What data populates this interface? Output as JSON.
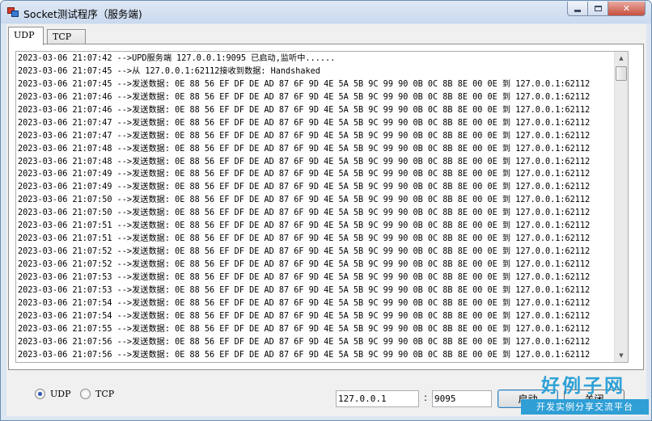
{
  "window": {
    "title": "Socket测试程序（服务端)"
  },
  "tabs": [
    {
      "label": "UDP",
      "active": true
    },
    {
      "label": "TCP",
      "active": false
    }
  ],
  "log": {
    "lines": [
      "2023-03-06 21:07:42 -->UPD服务端 127.0.0.1:9095 已启动,监听中......",
      "2023-03-06 21:07:45 -->从 127.0.0.1:62112接收到数据: Handshaked",
      "2023-03-06 21:07:45 -->发送数据: 0E 88 56 EF DF DE AD 87 6F 9D 4E 5A 5B 9C 99 90 0B 0C 8B 8E 00 0E 到 127.0.0.1:62112",
      "2023-03-06 21:07:46 -->发送数据: 0E 88 56 EF DF DE AD 87 6F 9D 4E 5A 5B 9C 99 90 0B 0C 8B 8E 00 0E 到 127.0.0.1:62112",
      "2023-03-06 21:07:46 -->发送数据: 0E 88 56 EF DF DE AD 87 6F 9D 4E 5A 5B 9C 99 90 0B 0C 8B 8E 00 0E 到 127.0.0.1:62112",
      "2023-03-06 21:07:47 -->发送数据: 0E 88 56 EF DF DE AD 87 6F 9D 4E 5A 5B 9C 99 90 0B 0C 8B 8E 00 0E 到 127.0.0.1:62112",
      "2023-03-06 21:07:47 -->发送数据: 0E 88 56 EF DF DE AD 87 6F 9D 4E 5A 5B 9C 99 90 0B 0C 8B 8E 00 0E 到 127.0.0.1:62112",
      "2023-03-06 21:07:48 -->发送数据: 0E 88 56 EF DF DE AD 87 6F 9D 4E 5A 5B 9C 99 90 0B 0C 8B 8E 00 0E 到 127.0.0.1:62112",
      "2023-03-06 21:07:48 -->发送数据: 0E 88 56 EF DF DE AD 87 6F 9D 4E 5A 5B 9C 99 90 0B 0C 8B 8E 00 0E 到 127.0.0.1:62112",
      "2023-03-06 21:07:49 -->发送数据: 0E 88 56 EF DF DE AD 87 6F 9D 4E 5A 5B 9C 99 90 0B 0C 8B 8E 00 0E 到 127.0.0.1:62112",
      "2023-03-06 21:07:49 -->发送数据: 0E 88 56 EF DF DE AD 87 6F 9D 4E 5A 5B 9C 99 90 0B 0C 8B 8E 00 0E 到 127.0.0.1:62112",
      "2023-03-06 21:07:50 -->发送数据: 0E 88 56 EF DF DE AD 87 6F 9D 4E 5A 5B 9C 99 90 0B 0C 8B 8E 00 0E 到 127.0.0.1:62112",
      "2023-03-06 21:07:50 -->发送数据: 0E 88 56 EF DF DE AD 87 6F 9D 4E 5A 5B 9C 99 90 0B 0C 8B 8E 00 0E 到 127.0.0.1:62112",
      "2023-03-06 21:07:51 -->发送数据: 0E 88 56 EF DF DE AD 87 6F 9D 4E 5A 5B 9C 99 90 0B 0C 8B 8E 00 0E 到 127.0.0.1:62112",
      "2023-03-06 21:07:51 -->发送数据: 0E 88 56 EF DF DE AD 87 6F 9D 4E 5A 5B 9C 99 90 0B 0C 8B 8E 00 0E 到 127.0.0.1:62112",
      "2023-03-06 21:07:52 -->发送数据: 0E 88 56 EF DF DE AD 87 6F 9D 4E 5A 5B 9C 99 90 0B 0C 8B 8E 00 0E 到 127.0.0.1:62112",
      "2023-03-06 21:07:52 -->发送数据: 0E 88 56 EF DF DE AD 87 6F 9D 4E 5A 5B 9C 99 90 0B 0C 8B 8E 00 0E 到 127.0.0.1:62112",
      "2023-03-06 21:07:53 -->发送数据: 0E 88 56 EF DF DE AD 87 6F 9D 4E 5A 5B 9C 99 90 0B 0C 8B 8E 00 0E 到 127.0.0.1:62112",
      "2023-03-06 21:07:53 -->发送数据: 0E 88 56 EF DF DE AD 87 6F 9D 4E 5A 5B 9C 99 90 0B 0C 8B 8E 00 0E 到 127.0.0.1:62112",
      "2023-03-06 21:07:54 -->发送数据: 0E 88 56 EF DF DE AD 87 6F 9D 4E 5A 5B 9C 99 90 0B 0C 8B 8E 00 0E 到 127.0.0.1:62112",
      "2023-03-06 21:07:54 -->发送数据: 0E 88 56 EF DF DE AD 87 6F 9D 4E 5A 5B 9C 99 90 0B 0C 8B 8E 00 0E 到 127.0.0.1:62112",
      "2023-03-06 21:07:55 -->发送数据: 0E 88 56 EF DF DE AD 87 6F 9D 4E 5A 5B 9C 99 90 0B 0C 8B 8E 00 0E 到 127.0.0.1:62112",
      "2023-03-06 21:07:56 -->发送数据: 0E 88 56 EF DF DE AD 87 6F 9D 4E 5A 5B 9C 99 90 0B 0C 8B 8E 00 0E 到 127.0.0.1:62112",
      "2023-03-06 21:07:56 -->发送数据: 0E 88 56 EF DF DE AD 87 6F 9D 4E 5A 5B 9C 99 90 0B 0C 8B 8E 00 0E 到 127.0.0.1:62112"
    ]
  },
  "protocol": {
    "options": [
      {
        "label": "UDP",
        "selected": true
      },
      {
        "label": "TCP",
        "selected": false
      }
    ]
  },
  "server": {
    "ip": "127.0.0.1",
    "separator": ":",
    "port": "9095"
  },
  "buttons": {
    "start": "启动",
    "stop": "关闭"
  },
  "watermark": {
    "brand": "好例子网",
    "tagline": "开发实例分享交流平台"
  },
  "colors": {
    "accent": "#2ea1d6",
    "close": "#c8503e"
  }
}
